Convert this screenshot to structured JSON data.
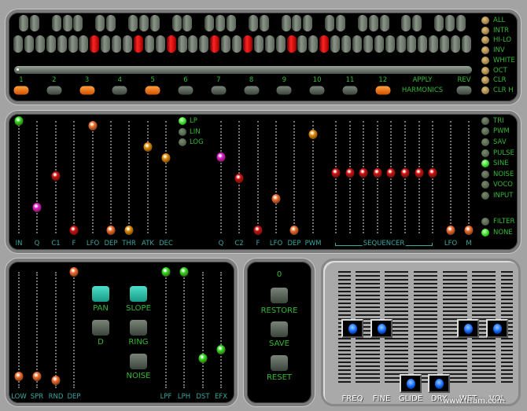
{
  "keyboard": {
    "white_keys": 42,
    "octaves": 6,
    "active_white_keys": [
      7,
      11,
      14,
      18,
      21,
      25,
      28
    ]
  },
  "harmonics": {
    "numbers": [
      "1",
      "2",
      "3",
      "4",
      "5",
      "6",
      "7",
      "8",
      "9",
      "10",
      "11",
      "12"
    ],
    "active": [
      1,
      3,
      5,
      12
    ],
    "apply_label": "APPLY",
    "harmonics_label": "HARMONICS",
    "rev_label": "REV",
    "slider_level": 0
  },
  "top_options": [
    "ALL",
    "INTR",
    "HI-LO",
    "INV",
    "WHITE",
    "OCT",
    "CLR",
    "CLR H"
  ],
  "filter_section": {
    "sliders": [
      {
        "label": "IN",
        "value": 1.0,
        "color": "#33dd22"
      },
      {
        "label": "Q",
        "value": 0.23,
        "color": "#dd22cc"
      },
      {
        "label": "C1",
        "value": 0.51,
        "color": "#cc1111"
      },
      {
        "label": "F",
        "value": 0.03,
        "color": "#cc1111"
      },
      {
        "label": "LFO",
        "value": 0.96,
        "color": "#f07030"
      },
      {
        "label": "DEP",
        "value": 0.03,
        "color": "#f07030"
      },
      {
        "label": "THR",
        "value": 0.03,
        "color": "#e0900a"
      },
      {
        "label": "ATK",
        "value": 0.77,
        "color": "#e0900a"
      },
      {
        "label": "DEC",
        "value": 0.67,
        "color": "#e0900a"
      },
      {
        "label": "Q",
        "value": 0.68,
        "color": "#dd22cc"
      },
      {
        "label": "C2",
        "value": 0.49,
        "color": "#cc1111"
      },
      {
        "label": "F",
        "value": 0.03,
        "color": "#cc1111"
      },
      {
        "label": "LFO",
        "value": 0.31,
        "color": "#f07030"
      },
      {
        "label": "DEP",
        "value": 0.03,
        "color": "#f07030"
      },
      {
        "label": "PWM",
        "value": 0.88,
        "color": "#e0900a"
      }
    ],
    "modes": [
      {
        "label": "LP",
        "on": true
      },
      {
        "label": "LIN",
        "on": false
      },
      {
        "label": "LOG",
        "on": false
      }
    ],
    "sequencer_label": "SEQUENCER",
    "sequencer_values": [
      0.54,
      0.54,
      0.54,
      0.54,
      0.54,
      0.54,
      0.54,
      0.54
    ],
    "lfo_sliders": [
      {
        "label": "LFO",
        "value": 0.03,
        "color": "#f07030"
      },
      {
        "label": "M",
        "value": 0.03,
        "color": "#f07030"
      }
    ],
    "waveforms": [
      {
        "label": "TRI",
        "on": false
      },
      {
        "label": "PWM",
        "on": false
      },
      {
        "label": "SAV",
        "on": false
      },
      {
        "label": "PULSE",
        "on": false
      },
      {
        "label": "SINE",
        "on": true
      },
      {
        "label": "NOISE",
        "on": false
      },
      {
        "label": "VOCO",
        "on": false
      },
      {
        "label": "INPUT",
        "on": false
      }
    ],
    "routing": [
      {
        "label": "FILTER",
        "on": false
      },
      {
        "label": "NONE",
        "on": true
      }
    ]
  },
  "effects": {
    "left_sliders": [
      {
        "label": "LOW",
        "value": 0.1,
        "color": "#f07030"
      },
      {
        "label": "SPR",
        "value": 0.1,
        "color": "#f07030"
      },
      {
        "label": "RND",
        "value": 0.07,
        "color": "#f07030"
      },
      {
        "label": "DEP",
        "value": 1.0,
        "color": "#f07030"
      }
    ],
    "buttons": [
      {
        "label": "PAN",
        "on": true
      },
      {
        "label": "SLOPE",
        "on": true
      },
      {
        "label": "D",
        "on": false
      },
      {
        "label": "RING",
        "on": false
      },
      {
        "label": "NOISE",
        "on": false
      }
    ],
    "right_sliders": [
      {
        "label": "LPF",
        "value": 1.0,
        "color": "#33dd22"
      },
      {
        "label": "LPH",
        "value": 1.0,
        "color": "#33dd22"
      },
      {
        "label": "DST",
        "value": 0.26,
        "color": "#33dd22"
      },
      {
        "label": "EFX",
        "value": 0.33,
        "color": "#33dd22"
      }
    ]
  },
  "presets": {
    "number": "0",
    "restore_label": "RESTORE",
    "save_label": "SAVE",
    "reset_label": "RESET"
  },
  "mixer": {
    "faders": [
      {
        "label": "FREQ",
        "value": 0.55
      },
      {
        "label": "FINE",
        "value": 0.55
      },
      {
        "label": "GLIDE",
        "value": 0.05
      },
      {
        "label": "DRY",
        "value": 0.05
      },
      {
        "label": "WET",
        "value": 0.55
      },
      {
        "label": "VOL",
        "value": 0.55
      }
    ]
  },
  "watermark": "www.frfam.com"
}
